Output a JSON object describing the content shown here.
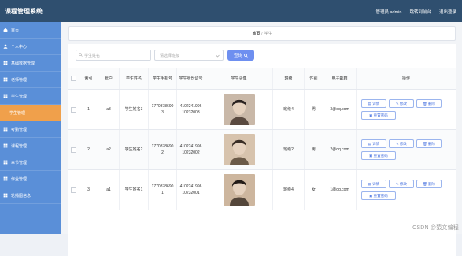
{
  "app": {
    "title": "课程管理系统",
    "greeting": "管理员 admin",
    "links": [
      "跳转到前台",
      "退出登录"
    ]
  },
  "sidebar": {
    "items": [
      {
        "label": "首页",
        "icon": "home-icon"
      },
      {
        "label": "个人中心",
        "icon": "user-icon"
      },
      {
        "label": "基础数据管理",
        "icon": "grid-icon"
      },
      {
        "label": "老师管理",
        "icon": "grid-icon"
      },
      {
        "label": "学生管理",
        "icon": "grid-icon"
      },
      {
        "label": "学生管理",
        "icon": "",
        "active": true
      },
      {
        "label": "考勤管理",
        "icon": "grid-icon"
      },
      {
        "label": "课程管理",
        "icon": "grid-icon"
      },
      {
        "label": "章节管理",
        "icon": "grid-icon"
      },
      {
        "label": "作业管理",
        "icon": "grid-icon"
      },
      {
        "label": "轮播图信息",
        "icon": "grid-icon"
      }
    ]
  },
  "breadcrumb": {
    "root": "首页",
    "sep": "/",
    "current": "学生"
  },
  "filters": {
    "name_placeholder": "学生姓名",
    "class_placeholder": "请选择班级",
    "query_label": "查询"
  },
  "actions": {
    "add_label": "新增",
    "delete_label": "删除"
  },
  "table": {
    "headers": [
      "索引",
      "账户",
      "学生姓名",
      "学生手机号",
      "学生身份证号",
      "学生头像",
      "班级",
      "性别",
      "电子邮箱",
      "操作"
    ],
    "rows": [
      {
        "index": "1",
        "account": "a3",
        "name": "学生姓名3",
        "phone": "17703786903",
        "id_card": "410224199610232003",
        "class": "班级4",
        "gender": "男",
        "email": "3@qq.com"
      },
      {
        "index": "2",
        "account": "a2",
        "name": "学生姓名2",
        "phone": "17703786902",
        "id_card": "410224199610232002",
        "class": "班级2",
        "gender": "男",
        "email": "2@qq.com"
      },
      {
        "index": "3",
        "account": "a1",
        "name": "学生姓名1",
        "phone": "17703786901",
        "id_card": "410224199610232001",
        "class": "班级4",
        "gender": "女",
        "email": "1@qq.com"
      }
    ],
    "row_actions": {
      "detail": "详情",
      "edit": "修改",
      "delete": "删除",
      "reset": "重置密码"
    }
  },
  "watermark": "CSDN @猿文编程",
  "colors": {
    "topbar": "#2f4f6f",
    "sidebar": "#5a8fd8",
    "active": "#f0a04b",
    "query": "#6e8ff0",
    "add": "#2ba55a",
    "delete": "#d9302c"
  }
}
